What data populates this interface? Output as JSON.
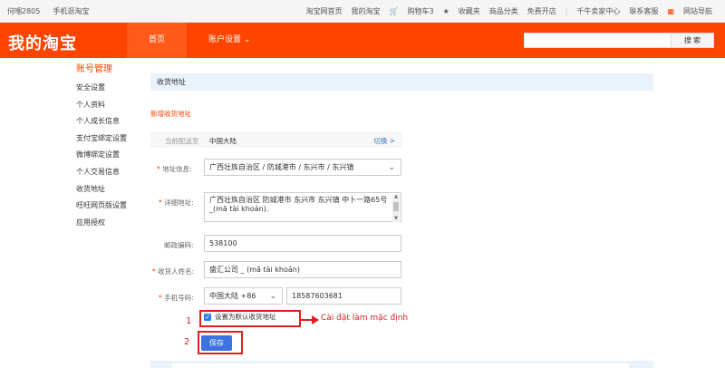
{
  "topbar": {
    "left": [
      "何嗰2805",
      "手机逛淘宝"
    ],
    "right": [
      "淘宝网首页",
      "我的淘宝",
      "购物车3",
      "收藏夹",
      "商品分类",
      "免费开店",
      "千牛卖家中心",
      "联系客服",
      "网站导航"
    ]
  },
  "header": {
    "logo": "我的淘宝",
    "nav": [
      "首页",
      "账户设置"
    ],
    "search_button": "搜 索",
    "search_placeholder": ""
  },
  "sidebar": {
    "title": "账号管理",
    "items": [
      "安全设置",
      "个人资料",
      "个人成长信息",
      "支付宝绑定设置",
      "微博绑定设置",
      "个人交易信息",
      "收货地址",
      "旺旺网页版设置",
      "应用授权"
    ]
  },
  "main": {
    "title": "收货地址",
    "new_address": "新增收货地址",
    "region_label": "当前配送至",
    "region_value": "中国大陆",
    "region_switch": "切换 >",
    "address_label": "地址信息:",
    "address_value": "广西壮族自治区 / 防城港市 / 东兴市 / 东兴镇",
    "detail_label": "详细地址:",
    "detail_value": "广西壮族自治区 防城港市 东兴市 东兴镇 中卜一路65号 _(mã tài khoản).",
    "postcode_label": "邮政编码:",
    "postcode_value": "538100",
    "name_label": "收货人姓名:",
    "name_value": "盛汇公司 _ (mã tài khoản)",
    "phone_label": "手机号码:",
    "phone_country": "中国大陆 +86",
    "phone_value": "18587603681",
    "default_checkbox": "设置为默认收货地址",
    "save_button": "保存"
  },
  "annotations": {
    "num1": "1",
    "num2": "2",
    "callout": "Cài đặt làm mặc định"
  },
  "colors": {
    "brand": "#ff4400",
    "link": "#3b73b9",
    "annotation": "#e02020",
    "button": "#3b73e0"
  }
}
